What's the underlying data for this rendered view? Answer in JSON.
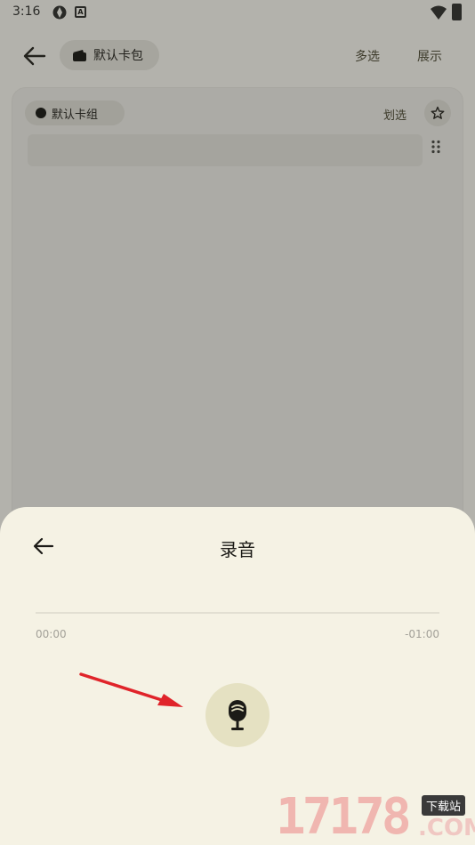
{
  "status_bar": {
    "time": "3:16"
  },
  "top_bar": {
    "wallet_label": "默认卡包",
    "multi_select_label": "多选",
    "show_label": "展示"
  },
  "card_group": {
    "group_label": "默认卡组",
    "scribble_label": "划选"
  },
  "record_sheet": {
    "title": "录音",
    "time_start": "00:00",
    "time_end": "-01:00"
  },
  "watermark": {
    "number": "17178",
    "tag": "下载站",
    "domain": ".COM"
  },
  "colors": {
    "sheet_bg": "#f5f2e4",
    "mic_bg": "#e5e1c2",
    "scrim": "#b3b2ac",
    "annotation_arrow": "#e0242a"
  }
}
